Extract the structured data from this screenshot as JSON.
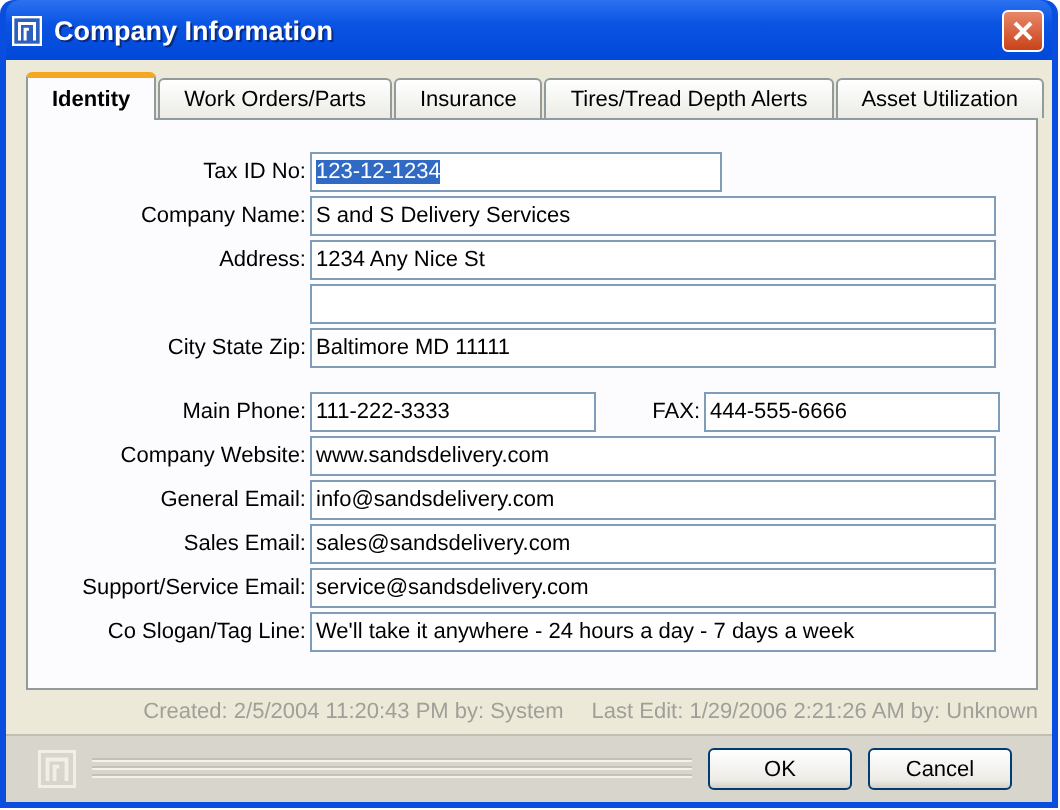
{
  "window": {
    "title": "Company Information"
  },
  "tabs": [
    {
      "label": "Identity",
      "selected": true
    },
    {
      "label": "Work Orders/Parts",
      "selected": false
    },
    {
      "label": "Insurance",
      "selected": false
    },
    {
      "label": "Tires/Tread Depth Alerts",
      "selected": false
    },
    {
      "label": "Asset Utilization",
      "selected": false
    }
  ],
  "sections": [
    [
      {
        "kind": "short",
        "label": "Tax ID No:",
        "value": "123-12-1234",
        "highlighted": true
      },
      {
        "kind": "full",
        "label": "Company Name:",
        "value": "S and S Delivery Services",
        "highlighted": false
      },
      {
        "kind": "full",
        "label": "Address:",
        "value": "1234 Any Nice St",
        "highlighted": false
      },
      {
        "kind": "full"
      },
      {
        "kind": "full",
        "label": "City State Zip:",
        "value": "Baltimore MD 11111",
        "highlighted": false
      }
    ],
    [
      {
        "kind": "pair",
        "label": "Main Phone:",
        "value": "111-222-3333",
        "label_2": "FAX:",
        "value_2": "444-555-6666",
        "highlighted": false
      },
      {
        "kind": "full",
        "label": "Company Website:",
        "value": "www.sandsdelivery.com",
        "highlighted": false
      },
      {
        "kind": "full",
        "label": "General Email:",
        "value": "info@sandsdelivery.com",
        "highlighted": false
      },
      {
        "kind": "full",
        "label": "Sales Email:",
        "value": "sales@sandsdelivery.com",
        "highlighted": false
      },
      {
        "kind": "full",
        "label": "Support/Service Email:",
        "value": "service@sandsdelivery.com",
        "highlighted": false
      },
      {
        "kind": "full",
        "label": "Co Slogan/Tag Line:",
        "value": "We'll take it anywhere - 24 hours a day - 7 days a week",
        "highlighted": false
      }
    ]
  ],
  "created": "Created: 2/5/2004 11:20:43 PM by: System",
  "last_edit": "Last Edit: 1/29/2006 2:21:26 AM by: Unknown",
  "buttons": [
    "OK",
    "Cancel"
  ]
}
